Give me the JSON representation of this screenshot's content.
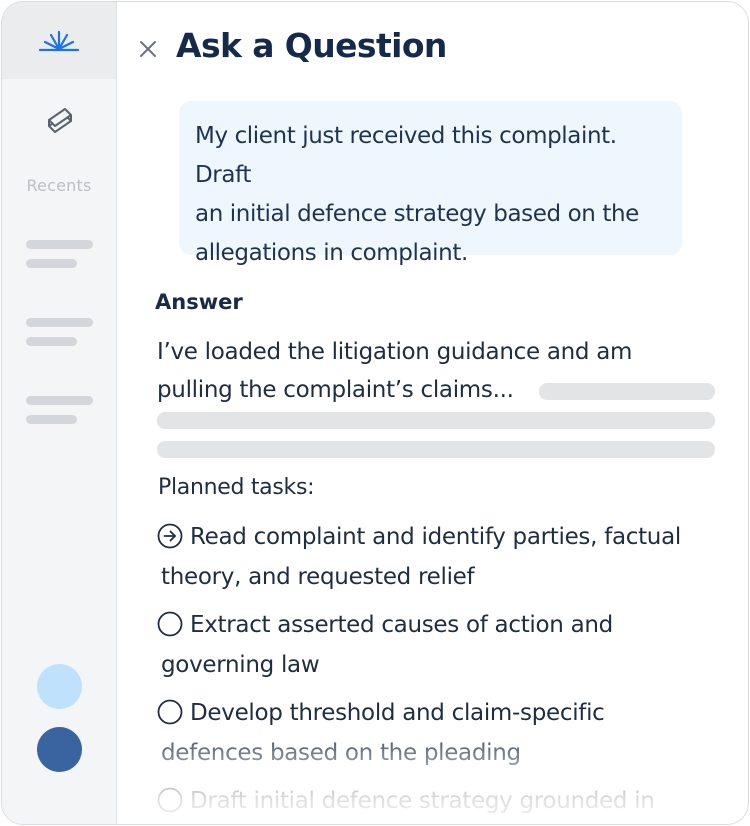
{
  "sidebar": {
    "logo_icon": "sunburst-logo-icon",
    "nav_icon": "stack-layers-icon",
    "recents_label": "Recents"
  },
  "header": {
    "close_icon": "close-icon",
    "title": "Ask a Question"
  },
  "question": {
    "lines": [
      "My client just received this complaint. Draft",
      "an initial defence strategy based on the",
      "allegations in complaint."
    ]
  },
  "answer": {
    "heading": "Answer",
    "lines": [
      "I’ve loaded the litigation guidance and am",
      "pulling the complaint’s claims..."
    ],
    "planned_label": "Planned tasks:",
    "tasks": [
      {
        "status": "in-progress",
        "icon": "arrow-circle-icon",
        "line1": "Read complaint and identify parties, factual",
        "line2": "theory, and requested relief"
      },
      {
        "status": "pending",
        "icon": "empty-circle-icon",
        "line1": "Extract asserted causes of action and",
        "line2": "governing law"
      },
      {
        "status": "pending",
        "icon": "empty-circle-icon",
        "line1": "Develop threshold and claim-specific",
        "line2": "defences based on the pleading"
      },
      {
        "status": "pending",
        "icon": "empty-circle-icon",
        "line1": "Draft initial defence strategy grounded in",
        "line2": ""
      }
    ]
  },
  "colors": {
    "brand_navy": "#152a4a",
    "accent_blue": "#1a73e8",
    "bubble_bg": "#eef7fd",
    "avatar_light": "#bfe1fb",
    "avatar_dark": "#3a64a0"
  }
}
